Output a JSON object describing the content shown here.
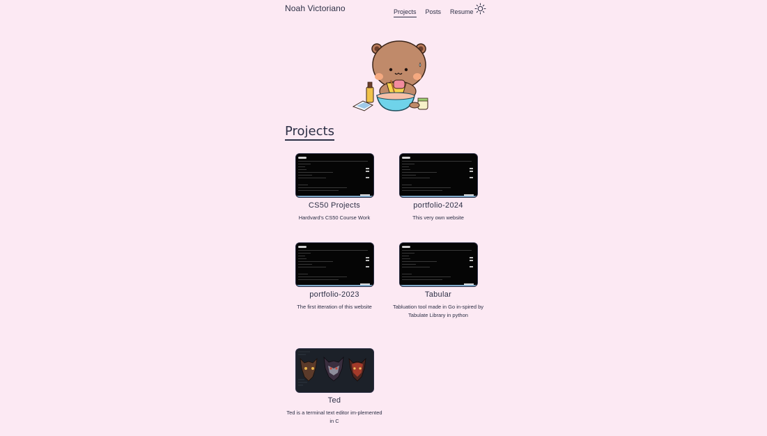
{
  "header": {
    "site_name": "Noah Victoriano",
    "nav": [
      "Projects",
      "Posts",
      "Resume"
    ],
    "active_nav": "Projects",
    "theme_toggle_icon": "sun-icon"
  },
  "hero": {
    "image": "bear-baking-illustration"
  },
  "section": {
    "title": "Projects"
  },
  "projects": [
    {
      "title": "CS50 Projects",
      "description": "Hardvard's CS50 Course Work",
      "thumbnail": "terminal-screenshot"
    },
    {
      "title": "portfolio-2024",
      "description": "This very own website",
      "thumbnail": "terminal-screenshot"
    },
    {
      "title": "portfolio-2023",
      "description": "The first itteration of this website",
      "thumbnail": "terminal-screenshot"
    },
    {
      "title": "Tabular",
      "description": "Tabluation tool made in Go in-spired by Tabulate Library in python",
      "thumbnail": "terminal-screenshot"
    },
    {
      "title": "Ted",
      "description": "Ted is a terminal text editor im-plemented in C",
      "thumbnail": "masks-screenshot"
    }
  ],
  "colors": {
    "background": "#fce9f3",
    "text": "#2c2f45",
    "thumbnail_dark": "#050505"
  }
}
